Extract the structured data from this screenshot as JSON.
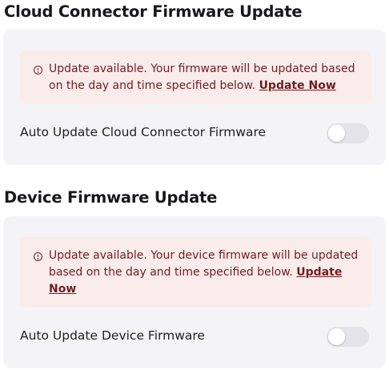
{
  "cloud_connector": {
    "title": "Cloud Connector Firmware Update",
    "alert": {
      "icon": "info-circle-icon",
      "message": "Update available. Your firmware will be updated based on the day and time specified below.",
      "link_label": "Update Now"
    },
    "setting_label": "Auto Update Cloud Connector Firmware",
    "toggle_on": false
  },
  "device": {
    "title": "Device Firmware Update",
    "alert": {
      "icon": "info-circle-icon",
      "message": "Update available. Your device firmware will be updated based on the day and time specified below.",
      "link_label": "Update Now"
    },
    "setting_label": "Auto Update Device Firmware",
    "toggle_on": false
  },
  "colors": {
    "card_background": "#f4f4f6",
    "alert_background": "#fbecec",
    "alert_text": "#6f1d22",
    "toggle_off_track": "#e4e4e8"
  }
}
